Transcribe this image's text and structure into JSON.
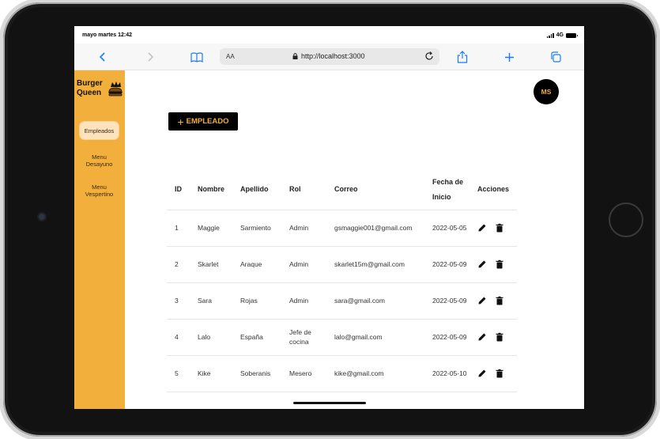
{
  "status": {
    "time": "mayo martes 12:42",
    "network": "4G"
  },
  "browser": {
    "aa_label": "AA",
    "url": "http://localhost:3000"
  },
  "brand": {
    "line1": "Burger",
    "line2": "Queen"
  },
  "sidebar": {
    "items": [
      {
        "label": "Empleados",
        "active": true
      },
      {
        "label": "Menu Desayuno",
        "active": false
      },
      {
        "label": "Menu Vespertino",
        "active": false
      }
    ]
  },
  "user": {
    "initials": "MS"
  },
  "add_button": {
    "plus": "+",
    "label": "EMPLEADO"
  },
  "table": {
    "headers": [
      "ID",
      "Nombre",
      "Apellido",
      "Rol",
      "Correo",
      "Fecha de Inicio",
      "Acciones"
    ],
    "rows": [
      [
        "1",
        "Maggie",
        "Sarmiento",
        "Admin",
        "gsmaggie001@gmail.com",
        "2022-05-05"
      ],
      [
        "2",
        "Skarlet",
        "Araque",
        "Admin",
        "skarlet15m@gmail.com",
        "2022-05-09"
      ],
      [
        "3",
        "Sara",
        "Rojas",
        "Admin",
        "sara@gmail.com",
        "2022-05-09"
      ],
      [
        "4",
        "Lalo",
        "España",
        "Jefe de cocina",
        "lalo@gmail.com",
        "2022-05-09"
      ],
      [
        "5",
        "Kike",
        "Soberanis",
        "Mesero",
        "kike@gmail.com",
        "2022-05-10"
      ]
    ]
  },
  "icons": {
    "edit": "pencil-icon",
    "delete": "trash-icon"
  },
  "colors": {
    "brand": "#f2af3c",
    "dark": "#000000",
    "nav_active": "#fde3bb"
  }
}
